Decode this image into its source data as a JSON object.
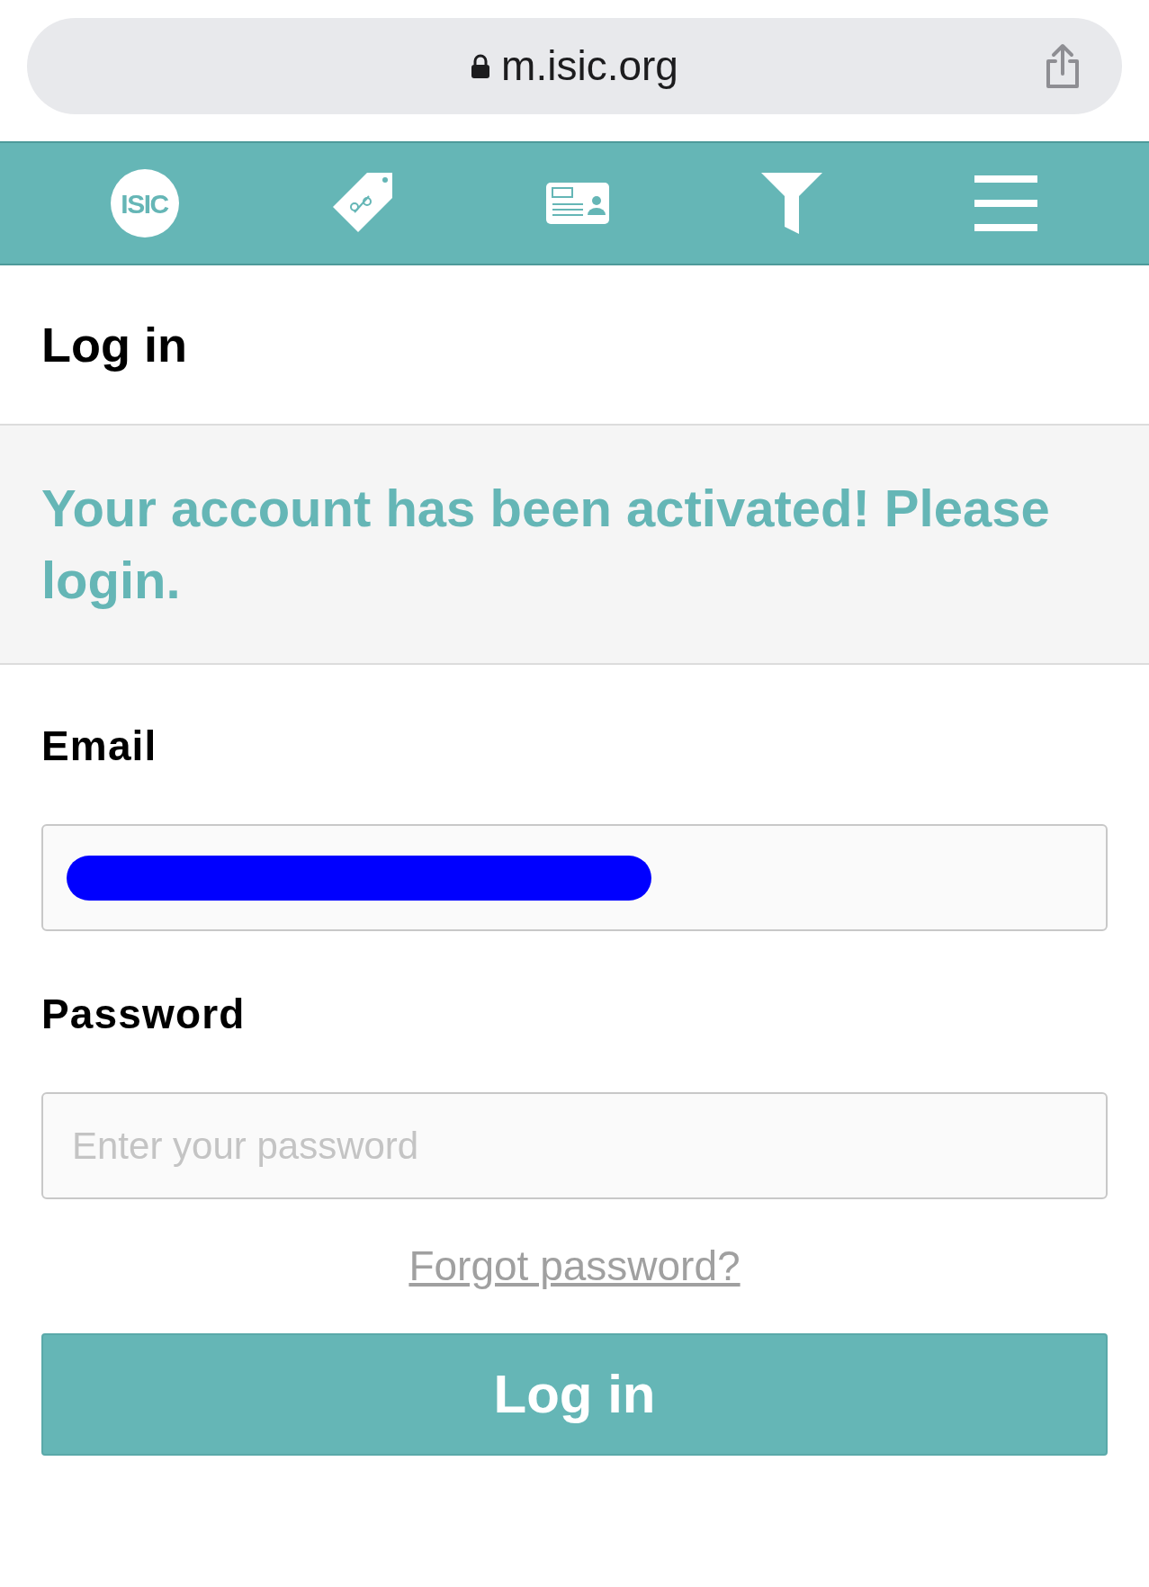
{
  "browser": {
    "url": "m.isic.org"
  },
  "nav": {
    "logo_text": "ISIC"
  },
  "title": "Log in",
  "message": "Your account has been activated! Please login.",
  "form": {
    "email": {
      "label": "Email",
      "redacted": true
    },
    "password": {
      "label": "Password",
      "placeholder": "Enter your password"
    },
    "forgot_link": "Forgot password?",
    "submit": "Log in"
  }
}
